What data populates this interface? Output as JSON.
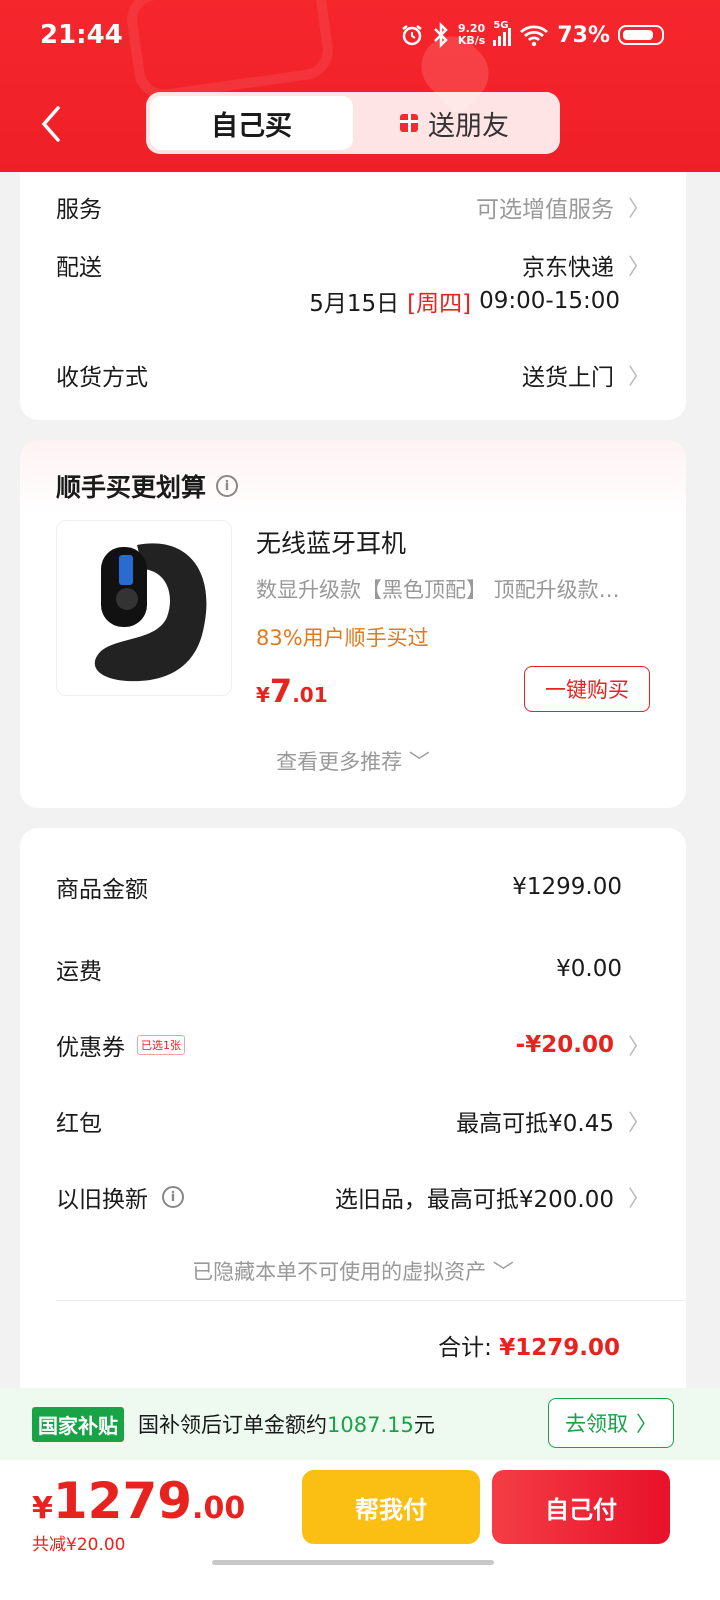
{
  "status_bar": {
    "time": "21:44",
    "net_speed_top": "9.20",
    "net_speed_bottom": "KB/s",
    "signal": "5G",
    "battery": "73%"
  },
  "header": {
    "tab_self": "自己买",
    "tab_gift": "送朋友"
  },
  "delivery_card": {
    "service_label": "服务",
    "service_value": "可选增值服务",
    "shipping_label": "配送",
    "shipping_value": "京东快递",
    "date_a": "5月15日",
    "date_b": "[周四]",
    "date_c": "09:00-15:00",
    "receive_label": "收货方式",
    "receive_value": "送货上门"
  },
  "recommend": {
    "title": "顺手买更划算",
    "product_name": "无线蓝牙耳机",
    "product_spec": "数显升级款【黑色顶配】  顶配升级款…",
    "percent_text": "83%用户顺手买过",
    "price_yen": "¥",
    "price_int": "7",
    "price_dec": ".01",
    "buy_button": "一键购买",
    "more": "查看更多推荐"
  },
  "summary": {
    "goods_label": "商品金额",
    "goods_value": "¥1299.00",
    "freight_label": "运费",
    "freight_value": "¥0.00",
    "coupon_label": "优惠券",
    "coupon_tag": "已选1张",
    "coupon_value": "-¥20.00",
    "redpacket_label": "红包",
    "redpacket_value": "最高可抵¥0.45",
    "tradein_label": "以旧换新",
    "tradein_value": "选旧品，最高可抵¥200.00",
    "hidden_assets": "已隐藏本单不可使用的虚拟资产",
    "total_label": "合计:",
    "total_value": "¥1279.00"
  },
  "subsidy": {
    "badge": "国家补贴",
    "text_a": "国补领后订单金额约",
    "text_amount": "1087.15",
    "text_b": "元",
    "button": "去领取"
  },
  "footer": {
    "price_yen": "¥",
    "price_int": "1279",
    "price_dec": ".00",
    "saved": "共减¥20.00",
    "help_pay": "帮我付",
    "self_pay": "自己付"
  },
  "colors": {
    "brand_red": "#e8231f",
    "header_red": "#f5262c",
    "subsidy_green": "#19a347",
    "help_yellow": "#fbbf14"
  }
}
